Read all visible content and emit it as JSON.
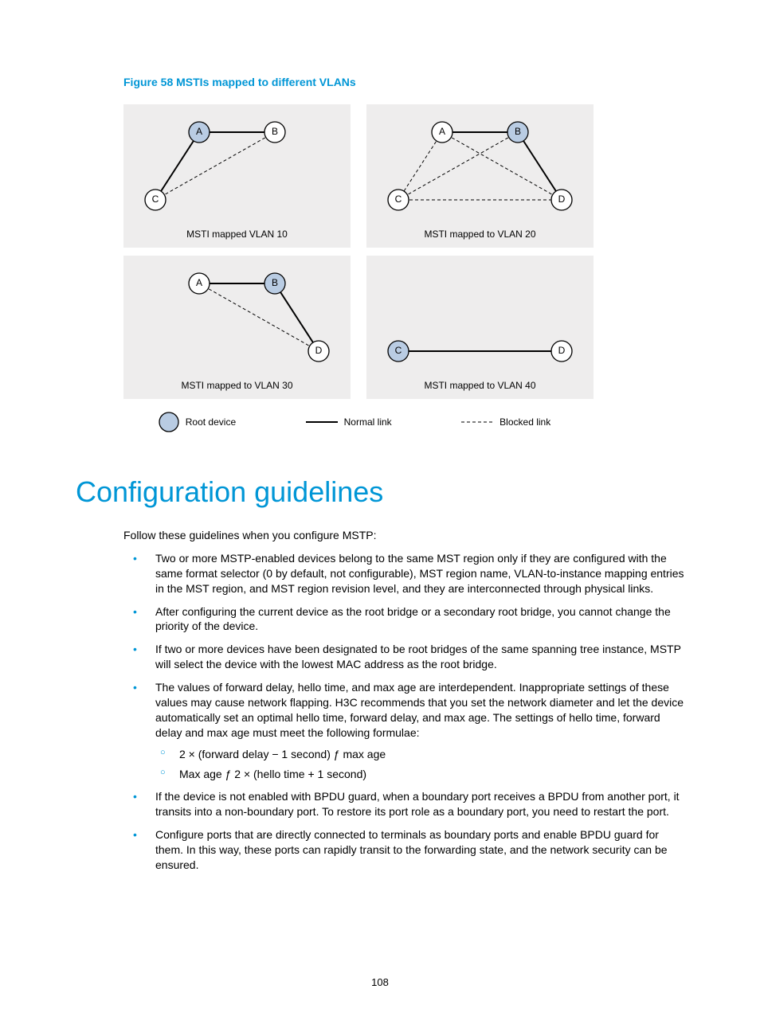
{
  "figure_caption": "Figure 58 MSTIs mapped to different VLANs",
  "panels": {
    "p1": {
      "caption": "MSTI mapped VLAN 10",
      "nodes": {
        "a": "A",
        "b": "B",
        "c": "C"
      }
    },
    "p2": {
      "caption": "MSTI mapped to VLAN 20",
      "nodes": {
        "a": "A",
        "b": "B",
        "c": "C",
        "d": "D"
      }
    },
    "p3": {
      "caption": "MSTI mapped to VLAN 30",
      "nodes": {
        "a": "A",
        "b": "B",
        "d": "D"
      }
    },
    "p4": {
      "caption": "MSTI mapped to VLAN 40",
      "nodes": {
        "c": "C",
        "d": "D"
      }
    }
  },
  "legend": {
    "root": "Root device",
    "normal": "Normal link",
    "blocked": "Blocked link"
  },
  "heading": "Configuration guidelines",
  "intro": "Follow these guidelines when you configure MSTP:",
  "bullets": [
    "Two or more MSTP-enabled devices belong to the same MST region only if they are configured with the same format selector (0 by default, not configurable), MST region name, VLAN-to-instance mapping entries in the MST region, and MST region revision level, and they are interconnected through physical links.",
    "After configuring the current device as the root bridge or a secondary root bridge, you cannot change the priority of the device.",
    "If two or more devices have been designated to be root bridges of the same spanning tree instance, MSTP will select the device with the lowest MAC address as the root bridge.",
    "The values of forward delay, hello time, and max age are interdependent. Inappropriate settings of these values may cause network flapping. H3C recommends that you set the network diameter and let the device automatically set an optimal hello time, forward delay, and max age. The settings of hello time, forward delay and max age must meet the following formulae:",
    "If the device is not enabled with BPDU guard, when a boundary port receives a BPDU from another port, it transits into a non-boundary port. To restore its port role as a boundary port, you need to restart the port.",
    "Configure ports that are directly connected to terminals as boundary ports and enable BPDU guard for them. In this way, these ports can rapidly transit to the forwarding state, and the network security can be ensured."
  ],
  "formulae": [
    "2 × (forward delay − 1 second) ƒ max age",
    "Max age ƒ 2 × (hello time + 1 second)"
  ],
  "page_number": "108"
}
